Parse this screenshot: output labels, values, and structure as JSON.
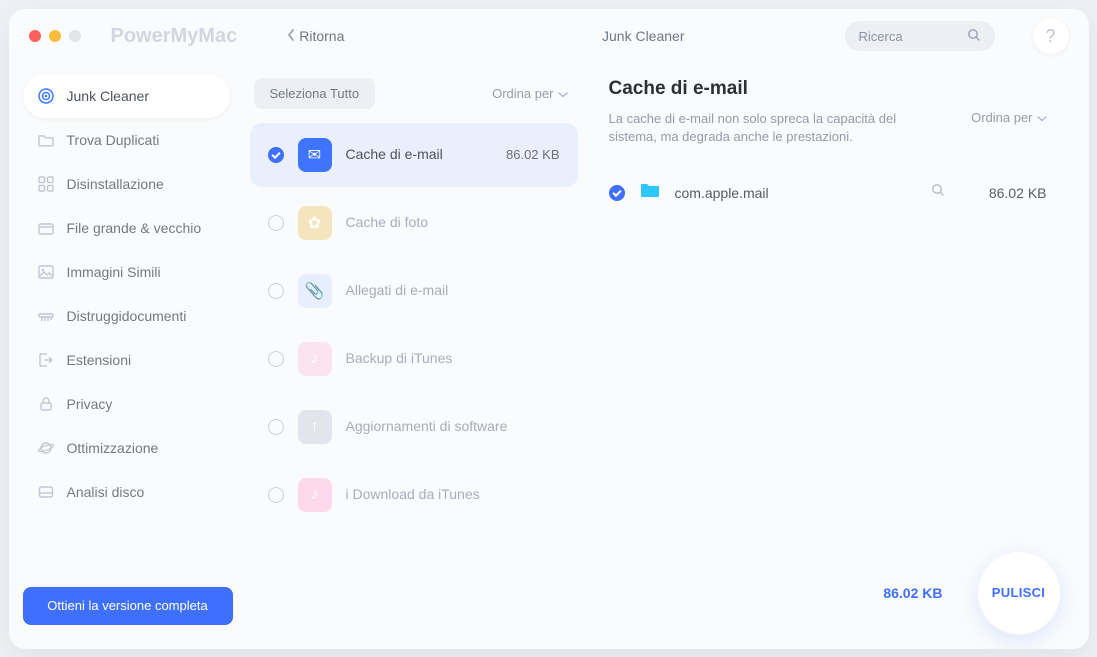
{
  "app_name": "PowerMyMac",
  "traffic": {
    "close": "#fc605c",
    "min": "#fdbc40",
    "max_disabled": "#e2e4e8"
  },
  "back_label": "Ritorna",
  "top_section": "Junk Cleaner",
  "search_placeholder": "Ricerca",
  "help_glyph": "?",
  "sidebar": {
    "items": [
      {
        "label": "Junk Cleaner",
        "active": true,
        "icon": "target-icon"
      },
      {
        "label": "Trova Duplicati",
        "active": false,
        "icon": "folder-icon"
      },
      {
        "label": "Disinstallazione",
        "active": false,
        "icon": "grid-icon"
      },
      {
        "label": "File grande & vecchio",
        "active": false,
        "icon": "box-icon"
      },
      {
        "label": "Immagini Simili",
        "active": false,
        "icon": "image-icon"
      },
      {
        "label": "Distruggidocumenti",
        "active": false,
        "icon": "shredder-icon"
      },
      {
        "label": "Estensioni",
        "active": false,
        "icon": "exit-icon"
      },
      {
        "label": "Privacy",
        "active": false,
        "icon": "lock-icon"
      },
      {
        "label": "Ottimizzazione",
        "active": false,
        "icon": "planet-icon"
      },
      {
        "label": "Analisi disco",
        "active": false,
        "icon": "disk-icon"
      }
    ],
    "upgrade_label": "Ottieni la versione completa"
  },
  "middle": {
    "select_all": "Seleziona Tutto",
    "sort_by": "Ordina per",
    "categories": [
      {
        "label": "Cache di e-mail",
        "size": "86.02 KB",
        "checked": true,
        "selected": true,
        "iconbg": "#3f74ff",
        "glyph": "✉"
      },
      {
        "label": "Cache di foto",
        "size": "",
        "checked": false,
        "selected": false,
        "iconbg": "#f6e4bf",
        "glyph": "✿"
      },
      {
        "label": "Allegati di e-mail",
        "size": "",
        "checked": false,
        "selected": false,
        "iconbg": "#e6eeff",
        "glyph": "📎"
      },
      {
        "label": "Backup di iTunes",
        "size": "",
        "checked": false,
        "selected": false,
        "iconbg": "#fbe3f0",
        "glyph": "♪"
      },
      {
        "label": "Aggiornamenti di software",
        "size": "",
        "checked": false,
        "selected": false,
        "iconbg": "#e2e5ec",
        "glyph": "↑"
      },
      {
        "label": "i Download da iTunes",
        "size": "",
        "checked": false,
        "selected": false,
        "iconbg": "#fdd9eb",
        "glyph": "♪"
      }
    ]
  },
  "right": {
    "title": "Cache di e-mail",
    "description": "La cache di e-mail non solo spreca la capacità del sistema, ma degrada anche le prestazioni.",
    "sort_by": "Ordina per",
    "items": [
      {
        "name": "com.apple.mail",
        "size": "86.02 KB",
        "checked": true
      }
    ]
  },
  "footer": {
    "total_size": "86.02 KB",
    "clean_label": "PULISCI"
  }
}
